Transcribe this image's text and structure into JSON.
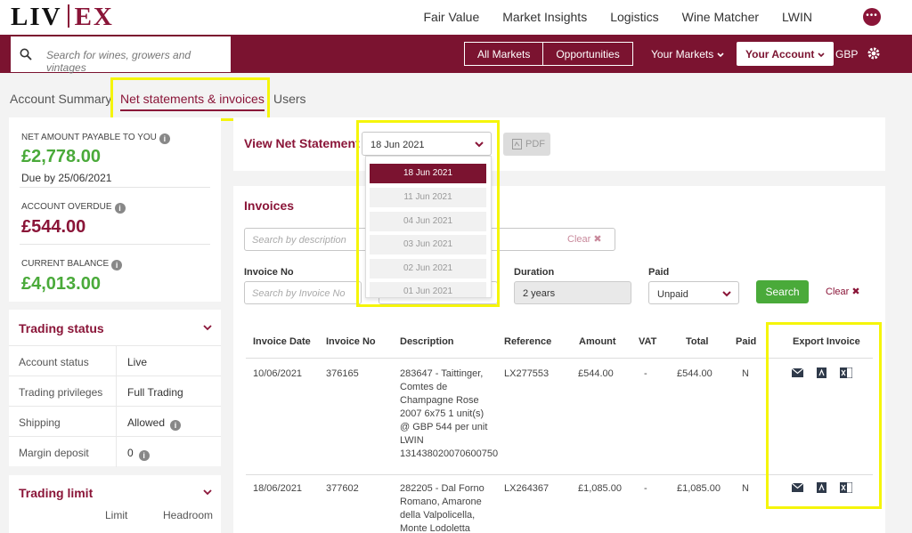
{
  "header": {
    "logo_left": "LIV",
    "logo_right": "EX",
    "nav": [
      "Fair Value",
      "Market Insights",
      "Logistics",
      "Wine Matcher",
      "LWIN"
    ],
    "more_glyph": "•••"
  },
  "search": {
    "placeholder": "Search for wines, growers and vintages",
    "icon": "search-icon"
  },
  "rednav": {
    "all_markets": "All Markets",
    "opportunities": "Opportunities",
    "your_markets": "Your Markets",
    "your_account": "Your Account",
    "currency": "GBP"
  },
  "tabs": [
    "Account Summary",
    "Net statements & invoices",
    "Users"
  ],
  "summary": {
    "net_label": "NET AMOUNT PAYABLE TO YOU",
    "net_amount": "£2,778.00",
    "due": "Due by 25/06/2021",
    "overdue_label": "ACCOUNT OVERDUE",
    "overdue_amount": "£544.00",
    "balance_label": "CURRENT BALANCE",
    "balance_amount": "£4,013.00"
  },
  "trading_status": {
    "title": "Trading status",
    "rows": [
      {
        "key": "Account status",
        "value": "Live"
      },
      {
        "key": "Trading privileges",
        "value": "Full Trading"
      },
      {
        "key": "Shipping",
        "value": "Allowed"
      },
      {
        "key": "Margin deposit",
        "value": "0"
      }
    ]
  },
  "trading_limit": {
    "title": "Trading limit",
    "col_limit": "Limit",
    "col_headroom": "Headroom"
  },
  "net_statement": {
    "title": "View Net Statement",
    "selected": "18 Jun 2021",
    "pdf": "PDF",
    "options": [
      "18 Jun 2021",
      "11 Jun 2021",
      "04 Jun 2021",
      "03 Jun 2021",
      "02 Jun 2021",
      "01 Jun 2021"
    ]
  },
  "invoices": {
    "title": "Invoices",
    "desc_placeholder": "Search by description",
    "clear_inline": "Clear ✖",
    "invoice_no_label": "Invoice No",
    "invoice_no_placeholder": "Search by Invoice No",
    "duration_label": "Duration",
    "duration_value": "2 years",
    "paid_label": "Paid",
    "paid_value": "Unpaid",
    "search_btn": "Search",
    "clear_btn": "Clear ✖"
  },
  "table": {
    "headers": [
      "Invoice Date",
      "Invoice No",
      "Description",
      "Reference",
      "Amount",
      "VAT",
      "Total",
      "Paid",
      "Export Invoice"
    ],
    "rows": [
      {
        "date": "10/06/2021",
        "no": "376165",
        "desc": [
          "283647 - Taittinger,",
          "Comtes de",
          "Champagne Rose",
          "2007 6x75 1 unit(s)",
          "@ GBP 544 per unit",
          "LWIN",
          "13143802007060075​0"
        ],
        "ref": "LX277553",
        "amount": "£544.00",
        "vat": "-",
        "total": "£544.00",
        "paid": "N"
      },
      {
        "date": "18/06/2021",
        "no": "377602",
        "desc": [
          "282205 - Dal Forno",
          "Romano, Amarone",
          "della Valpolicella,",
          "Monte Lodoletta"
        ],
        "ref": "LX264367",
        "amount": "£1,085.00",
        "vat": "-",
        "total": "£1,085.00",
        "paid": "N"
      }
    ]
  },
  "colors": {
    "brand": "#7b1330",
    "green": "#4aaa3a",
    "highlight": "#f5f50a"
  }
}
